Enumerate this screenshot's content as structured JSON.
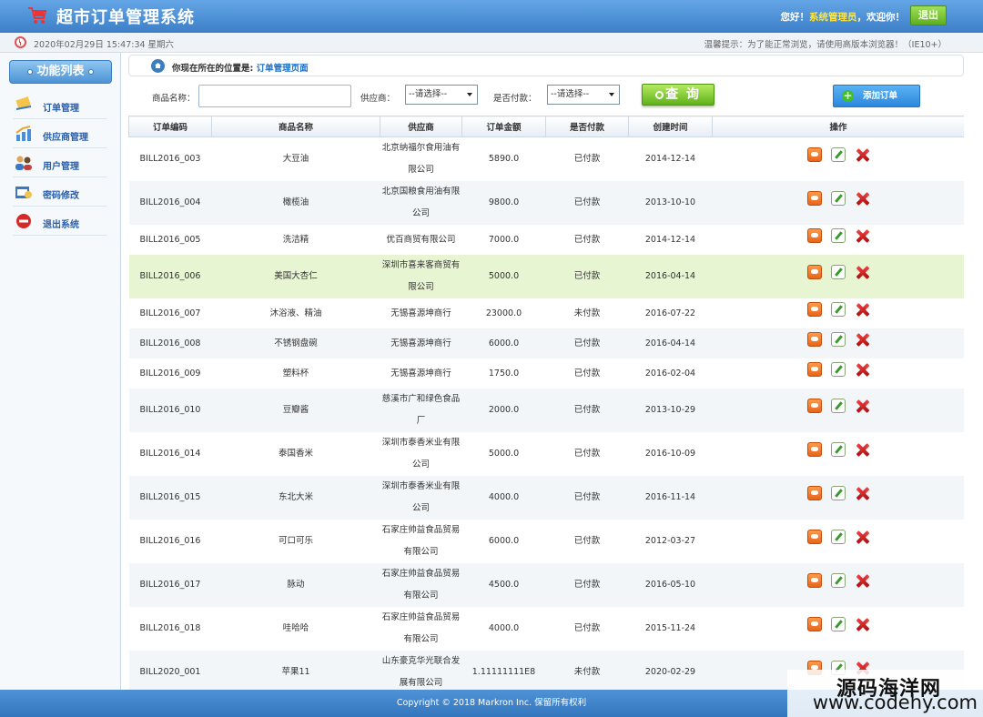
{
  "header": {
    "title": "超市订单管理系统",
    "greeting_prefix": "您好！",
    "username": "系统管理员",
    "greeting_suffix": "，欢迎你！",
    "logout_label": "退出"
  },
  "infobar": {
    "datetime": "2020年02月29日 15:47:34 星期六",
    "tips": "温馨提示：为了能正常浏览，请使用高版本浏览器！（IE10+）"
  },
  "sidebar": {
    "title": "功能列表",
    "items": [
      {
        "label": "订单管理",
        "icon": "order-icon"
      },
      {
        "label": "供应商管理",
        "icon": "provider-icon"
      },
      {
        "label": "用户管理",
        "icon": "users-icon"
      },
      {
        "label": "密码修改",
        "icon": "password-icon"
      },
      {
        "label": "退出系统",
        "icon": "exit-icon"
      }
    ]
  },
  "breadcrumb": {
    "prefix": "你现在所在的位置是:",
    "current": "订单管理页面"
  },
  "search": {
    "product_label": "商品名称：",
    "product_value": "",
    "provider_label": "供应商：",
    "provider_selected": "--请选择--",
    "paid_label": "是否付款：",
    "paid_selected": "--请选择--",
    "query_label": "查 询",
    "add_label": "添加订单"
  },
  "table": {
    "headers": [
      "订单编码",
      "商品名称",
      "供应商",
      "订单金额",
      "是否付款",
      "创建时间",
      "操作"
    ],
    "rows": [
      {
        "code": "BILL2016_003",
        "name": "大豆油",
        "provider": [
          "北京纳福尔食用油有",
          "限公司"
        ],
        "amount": "5890.0",
        "paid": "已付款",
        "date": "2014-12-14"
      },
      {
        "code": "BILL2016_004",
        "name": "橄榄油",
        "provider": [
          "北京国粮食用油有限",
          "公司"
        ],
        "amount": "9800.0",
        "paid": "已付款",
        "date": "2013-10-10"
      },
      {
        "code": "BILL2016_005",
        "name": "洗洁精",
        "provider": [
          "优百商贸有限公司"
        ],
        "amount": "7000.0",
        "paid": "已付款",
        "date": "2014-12-14"
      },
      {
        "code": "BILL2016_006",
        "name": "美国大杏仁",
        "provider": [
          "深圳市喜来客商贸有",
          "限公司"
        ],
        "amount": "5000.0",
        "paid": "已付款",
        "date": "2016-04-14"
      },
      {
        "code": "BILL2016_007",
        "name": "沐浴液、精油",
        "provider": [
          "无锡喜源坤商行"
        ],
        "amount": "23000.0",
        "paid": "未付款",
        "date": "2016-07-22"
      },
      {
        "code": "BILL2016_008",
        "name": "不锈钢盘碗",
        "provider": [
          "无锡喜源坤商行"
        ],
        "amount": "6000.0",
        "paid": "已付款",
        "date": "2016-04-14"
      },
      {
        "code": "BILL2016_009",
        "name": "塑料杯",
        "provider": [
          "无锡喜源坤商行"
        ],
        "amount": "1750.0",
        "paid": "已付款",
        "date": "2016-02-04"
      },
      {
        "code": "BILL2016_010",
        "name": "豆瓣酱",
        "provider": [
          "慈溪市广和绿色食品",
          "厂"
        ],
        "amount": "2000.0",
        "paid": "已付款",
        "date": "2013-10-29"
      },
      {
        "code": "BILL2016_014",
        "name": "泰国香米",
        "provider": [
          "深圳市泰香米业有限",
          "公司"
        ],
        "amount": "5000.0",
        "paid": "已付款",
        "date": "2016-10-09"
      },
      {
        "code": "BILL2016_015",
        "name": "东北大米",
        "provider": [
          "深圳市泰香米业有限",
          "公司"
        ],
        "amount": "4000.0",
        "paid": "已付款",
        "date": "2016-11-14"
      },
      {
        "code": "BILL2016_016",
        "name": "可口可乐",
        "provider": [
          "石家庄帅益食品贸易",
          "有限公司"
        ],
        "amount": "6000.0",
        "paid": "已付款",
        "date": "2012-03-27"
      },
      {
        "code": "BILL2016_017",
        "name": "脉动",
        "provider": [
          "石家庄帅益食品贸易",
          "有限公司"
        ],
        "amount": "4500.0",
        "paid": "已付款",
        "date": "2016-05-10"
      },
      {
        "code": "BILL2016_018",
        "name": "哇哈哈",
        "provider": [
          "石家庄帅益食品贸易",
          "有限公司"
        ],
        "amount": "4000.0",
        "paid": "已付款",
        "date": "2015-11-24"
      },
      {
        "code": "BILL2020_001",
        "name": "苹果11",
        "provider": [
          "山东豪克华光联合发",
          "展有限公司"
        ],
        "amount": "1.11111111E8",
        "paid": "未付款",
        "date": "2020-02-29"
      }
    ]
  },
  "footer": {
    "copyright": "Copyright © 2018 Markron Inc. 保留所有权利"
  },
  "watermark": {
    "line1": "源码海洋网",
    "line2": "www.codehy.com"
  }
}
